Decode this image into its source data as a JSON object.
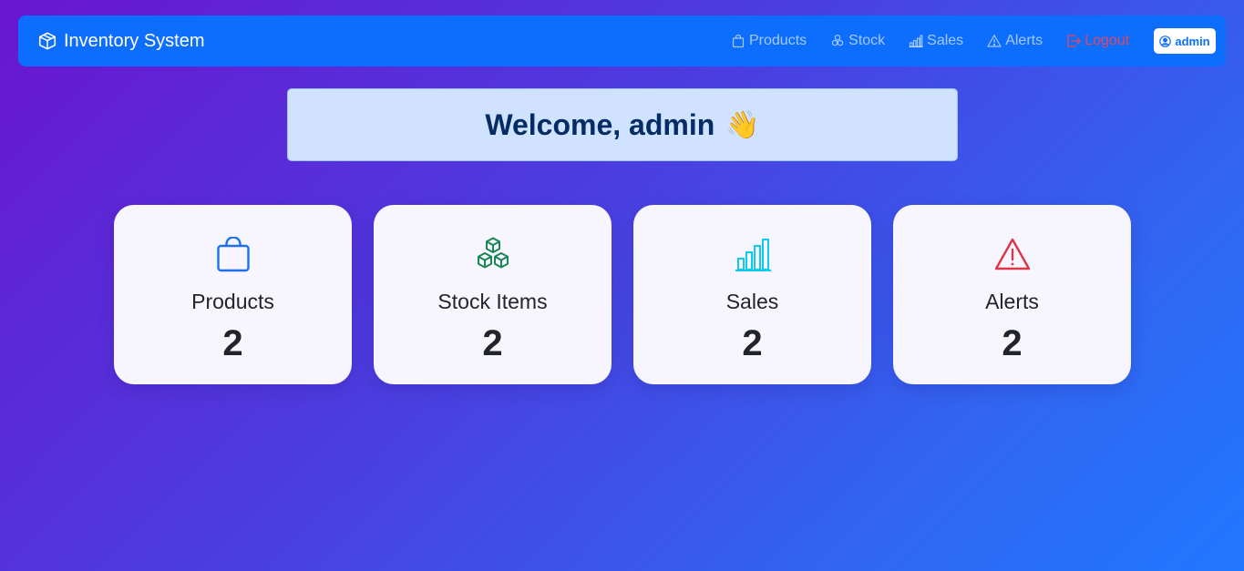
{
  "navbar": {
    "brand": "Inventory System",
    "brand_icon": "box-icon",
    "links": [
      {
        "label": "Products",
        "icon": "bag-icon"
      },
      {
        "label": "Stock",
        "icon": "boxes-icon"
      },
      {
        "label": "Sales",
        "icon": "bar-chart-icon"
      },
      {
        "label": "Alerts",
        "icon": "warning-icon"
      },
      {
        "label": "Logout",
        "icon": "logout-icon"
      }
    ],
    "user": "admin",
    "colors": {
      "bar": "#0d6efd",
      "logout": "#e34660"
    }
  },
  "welcome": {
    "text": "Welcome, admin",
    "emoji": "👋"
  },
  "cards": [
    {
      "label": "Products",
      "value": "2",
      "icon": "bag-icon",
      "color": "#1e6ef0"
    },
    {
      "label": "Stock Items",
      "value": "2",
      "icon": "boxes-icon",
      "color": "#198754"
    },
    {
      "label": "Sales",
      "value": "2",
      "icon": "bar-chart-icon",
      "color": "#0dcaf0"
    },
    {
      "label": "Alerts",
      "value": "2",
      "icon": "warning-icon",
      "color": "#dc3545"
    }
  ]
}
